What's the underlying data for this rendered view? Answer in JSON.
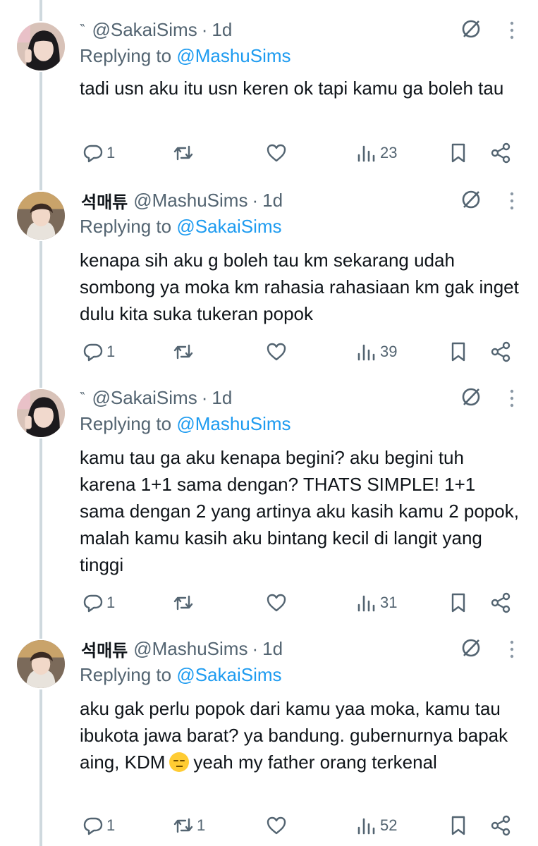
{
  "tweets": [
    {
      "prefix": "‶",
      "display_name": "",
      "handle": "@SakaiSims",
      "time": "1d",
      "replying_label": "Replying to ",
      "replying_to": "@MashuSims",
      "text": "tadi usn aku itu usn keren ok tapi kamu ga boleh tau",
      "replies": "1",
      "retweets": "",
      "likes": "",
      "views": "23",
      "avatar": "girl-avatar"
    },
    {
      "prefix": "",
      "display_name": "석매튜",
      "handle": "@MashuSims",
      "time": "1d",
      "replying_label": "Replying to ",
      "replying_to": "@SakaiSims",
      "text": "kenapa sih aku g boleh tau km sekarang udah sombong ya moka km rahasia rahasiaan km gak inget dulu kita suka tukeran popok",
      "replies": "1",
      "retweets": "",
      "likes": "",
      "views": "39",
      "avatar": "boy-avatar"
    },
    {
      "prefix": "‶",
      "display_name": "",
      "handle": "@SakaiSims",
      "time": "1d",
      "replying_label": "Replying to ",
      "replying_to": "@MashuSims",
      "text": "kamu tau ga aku kenapa begini? aku begini tuh karena 1+1 sama dengan? THATS SIMPLE! 1+1 sama dengan 2 yang artinya aku kasih kamu 2 popok, malah kamu kasih aku bintang kecil di langit yang tinggi",
      "replies": "1",
      "retweets": "",
      "likes": "",
      "views": "31",
      "avatar": "girl-avatar"
    },
    {
      "prefix": "",
      "display_name": "석매튜",
      "handle": "@MashuSims",
      "time": "1d",
      "replying_label": "Replying to ",
      "replying_to": "@SakaiSims",
      "text_before_emoji": "aku gak perlu popok dari kamu yaa moka, kamu tau ibukota jawa barat? ya bandung. gubernurnya bapak aing, KDM",
      "emoji": "relieved-face-emoji",
      "text_after_emoji": "yeah my father orang terkenal",
      "replies": "1",
      "retweets": "1",
      "likes": "",
      "views": "52",
      "avatar": "boy-avatar"
    }
  ],
  "icons": {
    "reply": "reply-icon",
    "retweet": "retweet-icon",
    "like": "like-icon",
    "views": "views-icon",
    "bookmark": "bookmark-icon",
    "share": "share-icon",
    "grok": "grok-icon",
    "more": "more-icon"
  },
  "colors": {
    "text": "#0f1419",
    "secondary": "#536471",
    "link": "#1d9bf0",
    "thread_line": "#cfd9de"
  }
}
